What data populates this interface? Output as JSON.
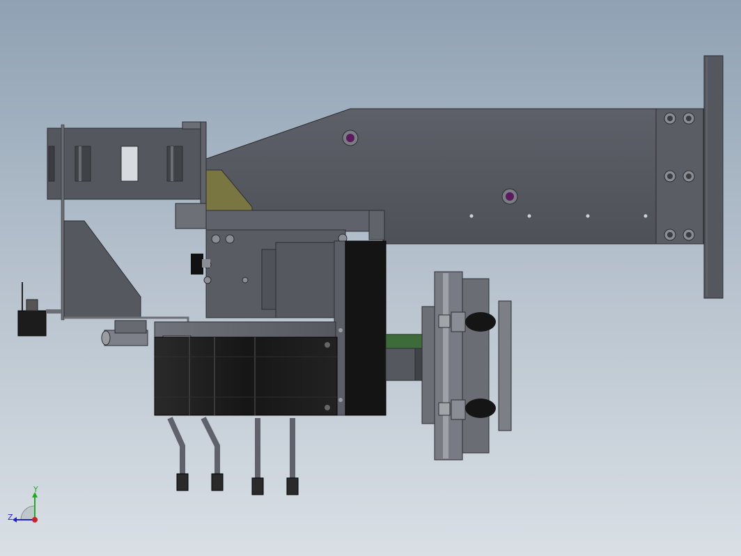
{
  "view": {
    "background_top": "#8fa1b3",
    "background_bottom": "#d9dfe5",
    "part_color": "#5b5e66",
    "motor_color": "#1b1b1b",
    "bracket_color": "#7a7642",
    "accent_green": "#3d6b3a",
    "hole_purple": "#5c1a5e"
  },
  "triad": {
    "x_axis_color": "#2222cc",
    "y_axis_color": "#22aa22",
    "z_label": "Z",
    "y_label": "Y",
    "origin_color": "#cc2222"
  }
}
